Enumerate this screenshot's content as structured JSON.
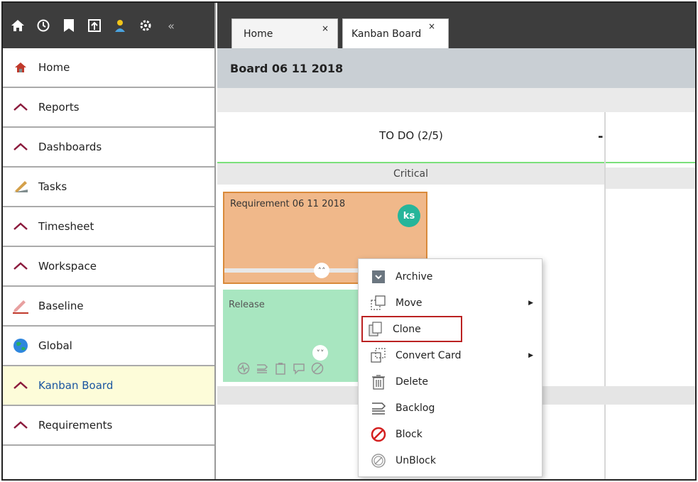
{
  "sidebar": {
    "toolbar_icons": [
      "home-icon",
      "history-icon",
      "bookmark-icon",
      "export-icon",
      "user-icon",
      "settings-icon"
    ],
    "collapse_label": "«",
    "items": [
      {
        "label": "Home",
        "icon": "home-nav-icon"
      },
      {
        "label": "Reports",
        "icon": "chevron-up-icon"
      },
      {
        "label": "Dashboards",
        "icon": "chevron-up-icon"
      },
      {
        "label": "Tasks",
        "icon": "tasks-icon"
      },
      {
        "label": "Timesheet",
        "icon": "chevron-up-icon"
      },
      {
        "label": "Workspace",
        "icon": "chevron-up-icon"
      },
      {
        "label": "Baseline",
        "icon": "pencil-icon"
      },
      {
        "label": "Global",
        "icon": "globe-icon"
      },
      {
        "label": "Kanban Board",
        "icon": "chevron-up-icon",
        "active": true
      },
      {
        "label": "Requirements",
        "icon": "chevron-up-icon"
      }
    ]
  },
  "tabs": [
    {
      "label": "Home",
      "close": "×"
    },
    {
      "label": "Kanban Board",
      "close": "×"
    }
  ],
  "board": {
    "title": "Board 06 11 2018",
    "column_title": "TO DO (2/5)",
    "column_collapse": "-",
    "lane_title": "Critical",
    "cards": [
      {
        "title": "Requirement 06 11 2018",
        "avatar": "ks",
        "color": "#f0b88a"
      },
      {
        "title": "Release",
        "color": "#a8e6c0"
      }
    ]
  },
  "context_menu": {
    "items": [
      {
        "label": "Archive",
        "icon": "archive-icon"
      },
      {
        "label": "Move",
        "icon": "move-icon",
        "submenu": true
      },
      {
        "label": "Clone",
        "icon": "clone-icon",
        "highlighted": true
      },
      {
        "label": "Convert Card",
        "icon": "convert-icon",
        "submenu": true
      },
      {
        "label": "Delete",
        "icon": "trash-icon"
      },
      {
        "label": "Backlog",
        "icon": "backlog-icon"
      },
      {
        "label": "Block",
        "icon": "block-icon"
      },
      {
        "label": "UnBlock",
        "icon": "unblock-icon"
      }
    ]
  },
  "colors": {
    "accent": "#b22222",
    "nav_chevron": "#8b1a3c",
    "active_row": "#fdfcd9",
    "avatar": "#26b59a"
  }
}
